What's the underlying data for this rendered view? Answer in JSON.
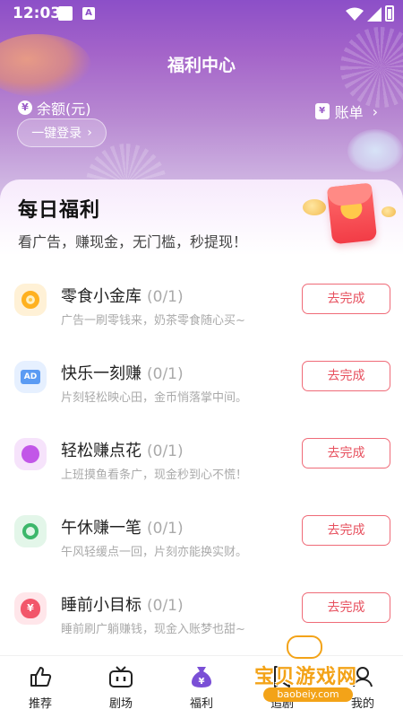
{
  "status_bar": {
    "time": "12:03",
    "a_label": "A"
  },
  "header": {
    "title": "福利中心",
    "balance_label": "余额(元)",
    "balance_icon": "¥",
    "bill_label": "账单",
    "bill_icon": "¥",
    "chevron": "›",
    "login_label": "一键登录",
    "login_chevron": "›"
  },
  "daily": {
    "title": "每日福利",
    "subtitle": "看广告，赚现金，无门槛，秒提现！"
  },
  "tasks": [
    {
      "name": "零食小金库",
      "count": "(0/1)",
      "desc": "广告一刷零钱来，奶茶零食随心买~",
      "button": "去完成",
      "icon": "snack-coin-icon"
    },
    {
      "name": "快乐一刻赚",
      "count": "(0/1)",
      "desc": "片刻轻松映心田，金币悄落掌中间。",
      "button": "去完成",
      "icon": "ad-icon",
      "icon_text": "AD"
    },
    {
      "name": "轻松赚点花",
      "count": "(0/1)",
      "desc": "上班摸鱼看条广，现金秒到心不慌！",
      "button": "去完成",
      "icon": "coin-stack-icon"
    },
    {
      "name": "午休赚一笔",
      "count": "(0/1)",
      "desc": "午风轻缓点一回，片刻亦能换实财。",
      "button": "去完成",
      "icon": "green-ring-icon"
    },
    {
      "name": "睡前小目标",
      "count": "(0/1)",
      "desc": "睡前刷广躺赚钱，现金入账梦也甜~",
      "button": "去完成",
      "icon": "money-bag-icon",
      "icon_text": "¥"
    }
  ],
  "tabbar": [
    {
      "label": "推荐",
      "icon": "thumbs-up-icon"
    },
    {
      "label": "剧场",
      "icon": "tv-icon"
    },
    {
      "label": "福利",
      "icon": "money-bag-icon",
      "icon_text": "¥"
    },
    {
      "label": "追剧",
      "icon": "bookmark-icon"
    },
    {
      "label": "我的",
      "icon": "profile-icon"
    }
  ],
  "watermark": {
    "text": "宝贝游戏网",
    "url": "baobeiy.com"
  },
  "colors": {
    "accent": "#e7505e",
    "hero_top": "#8c4fc8",
    "active_tab": "#7a4fd6"
  }
}
